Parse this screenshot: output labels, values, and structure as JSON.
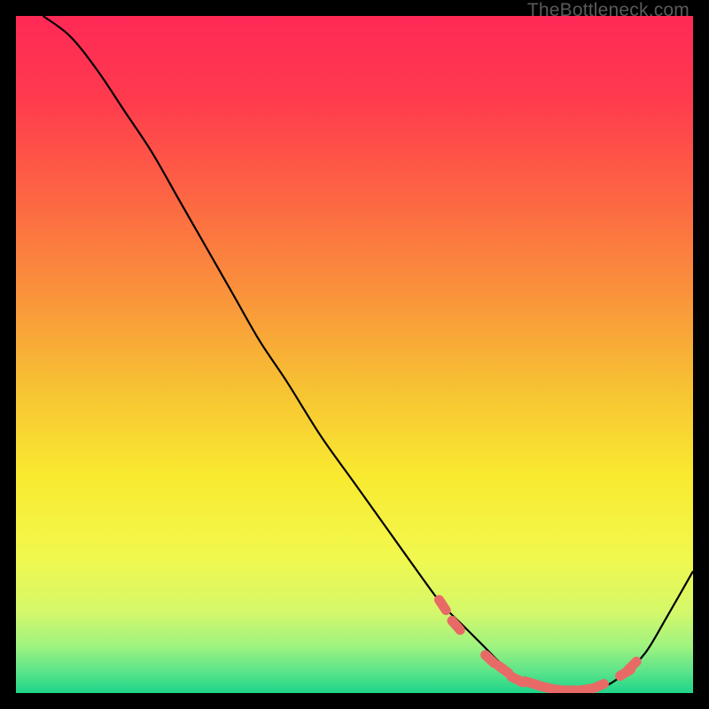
{
  "watermark": "TheBottleneck.com",
  "chart_data": {
    "type": "line",
    "title": "",
    "xlabel": "",
    "ylabel": "",
    "xlim": [
      0,
      100
    ],
    "ylim": [
      0,
      100
    ],
    "series": [
      {
        "name": "bottleneck-curve",
        "color": "#000000",
        "x": [
          4,
          8,
          12,
          16,
          20,
          24,
          28,
          32,
          36,
          40,
          45,
          50,
          55,
          60,
          63,
          66,
          69,
          72,
          75,
          78,
          81,
          84,
          87,
          90,
          93,
          96,
          100
        ],
        "y": [
          100,
          97,
          92,
          86,
          80,
          73,
          66,
          59,
          52,
          46,
          38,
          31,
          24,
          17,
          13,
          10,
          7,
          4,
          2,
          1,
          0.5,
          0.5,
          1,
          3,
          6,
          11,
          18
        ]
      },
      {
        "name": "highlighted-points",
        "type": "scatter",
        "color": "#e86a66",
        "x": [
          63,
          65,
          70,
          72,
          74,
          76,
          78,
          80,
          82,
          84,
          86,
          90,
          91
        ],
        "y": [
          13,
          10,
          5,
          3.5,
          2,
          1.5,
          0.9,
          0.5,
          0.4,
          0.5,
          1,
          3,
          4
        ]
      }
    ],
    "gradient_bands": [
      {
        "pos": 0.0,
        "color": "#ff2956"
      },
      {
        "pos": 0.12,
        "color": "#ff3a4e"
      },
      {
        "pos": 0.25,
        "color": "#fd6044"
      },
      {
        "pos": 0.4,
        "color": "#fa8f3c"
      },
      {
        "pos": 0.55,
        "color": "#f7c233"
      },
      {
        "pos": 0.68,
        "color": "#f9ea30"
      },
      {
        "pos": 0.8,
        "color": "#f1f84e"
      },
      {
        "pos": 0.88,
        "color": "#d4f86a"
      },
      {
        "pos": 0.93,
        "color": "#a0f380"
      },
      {
        "pos": 0.97,
        "color": "#58e38a"
      },
      {
        "pos": 1.0,
        "color": "#1dd58a"
      }
    ]
  }
}
